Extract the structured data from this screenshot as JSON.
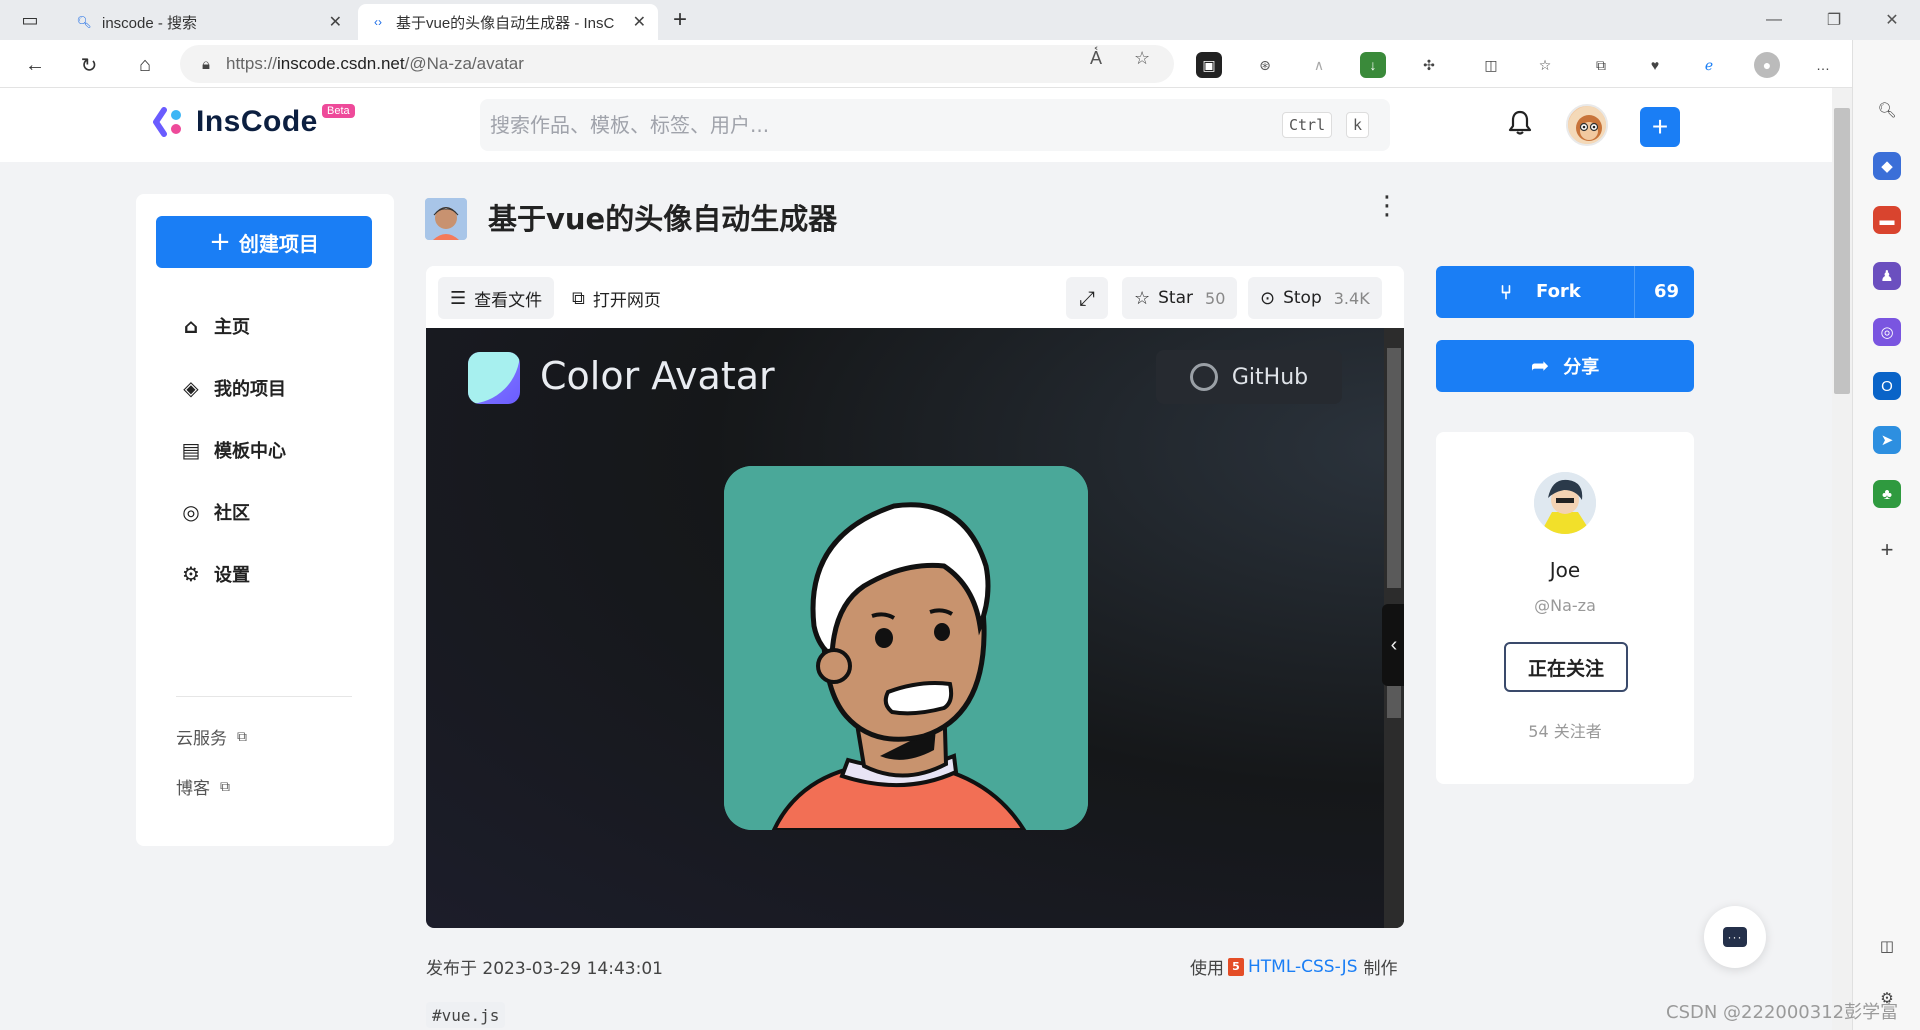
{
  "browser": {
    "tabs": [
      {
        "title": "inscode - 搜索",
        "active": false
      },
      {
        "title": "基于vue的头像自动生成器 - InsC",
        "active": true
      }
    ],
    "url_prefix": "https://",
    "url_host": "inscode.csdn.net",
    "url_path": "/@Na-za/avatar"
  },
  "header": {
    "logo_text": "InsCode",
    "beta_badge": "Beta",
    "search_placeholder": "搜索作品、模板、标签、用户...",
    "shortcut_key1": "Ctrl",
    "shortcut_key2": "k"
  },
  "sidebar": {
    "create_label": "创建项目",
    "items": [
      {
        "label": "主页",
        "icon": "home-icon"
      },
      {
        "label": "我的项目",
        "icon": "layers-icon"
      },
      {
        "label": "模板中心",
        "icon": "template-icon"
      },
      {
        "label": "社区",
        "icon": "community-icon"
      },
      {
        "label": "设置",
        "icon": "settings-icon"
      }
    ],
    "links": [
      {
        "label": "云服务",
        "icon": "external-link-icon"
      },
      {
        "label": "博客",
        "icon": "external-link-icon"
      }
    ]
  },
  "project": {
    "title": "基于vue的头像自动生成器",
    "view_files_label": "查看文件",
    "open_page_label": "打开网页",
    "star_label": "Star",
    "star_count": "50",
    "stop_label": "Stop",
    "stop_count": "3.4K",
    "published_label": "发布于",
    "published_at": "2023-03-29 14:43:01",
    "made_with_prefix": "使用",
    "tech": "HTML-CSS-JS",
    "made_with_suffix": "制作",
    "tags": [
      "#vue.js"
    ]
  },
  "preview": {
    "app_title": "Color Avatar",
    "github_label": "GitHub",
    "card_color": "#4aa899"
  },
  "actions": {
    "fork_label": "Fork",
    "fork_count": "69",
    "share_label": "分享"
  },
  "author": {
    "name": "Joe",
    "handle": "@Na-za",
    "follow_label": "正在关注",
    "followers": "54 关注者"
  },
  "watermark": "CSDN @222000312彭学富",
  "colors": {
    "primary": "#1a7ef5",
    "beta": "#ee4a9a"
  }
}
